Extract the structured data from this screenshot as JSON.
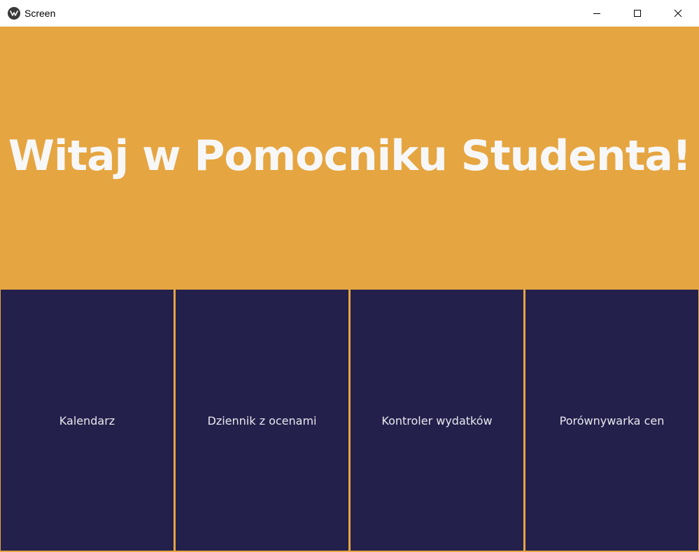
{
  "window": {
    "title": "Screen",
    "app_icon": "kivy-logo-icon",
    "controls": {
      "minimize_icon": "minimize-icon",
      "maximize_icon": "maximize-icon",
      "close_icon": "close-icon"
    }
  },
  "header": {
    "title": "Witaj w Pomocniku Studenta!"
  },
  "nav": {
    "items": [
      {
        "label": "Kalendarz"
      },
      {
        "label": "Dziennik z ocenami"
      },
      {
        "label": "Kontroler wydatków"
      },
      {
        "label": "Porównywarka cen"
      }
    ]
  },
  "colors": {
    "background": "#e5a541",
    "tile": "#24204c",
    "title_text": "#f7f7f7",
    "tile_text": "#e8e8ee",
    "titlebar": "#ffffff"
  }
}
